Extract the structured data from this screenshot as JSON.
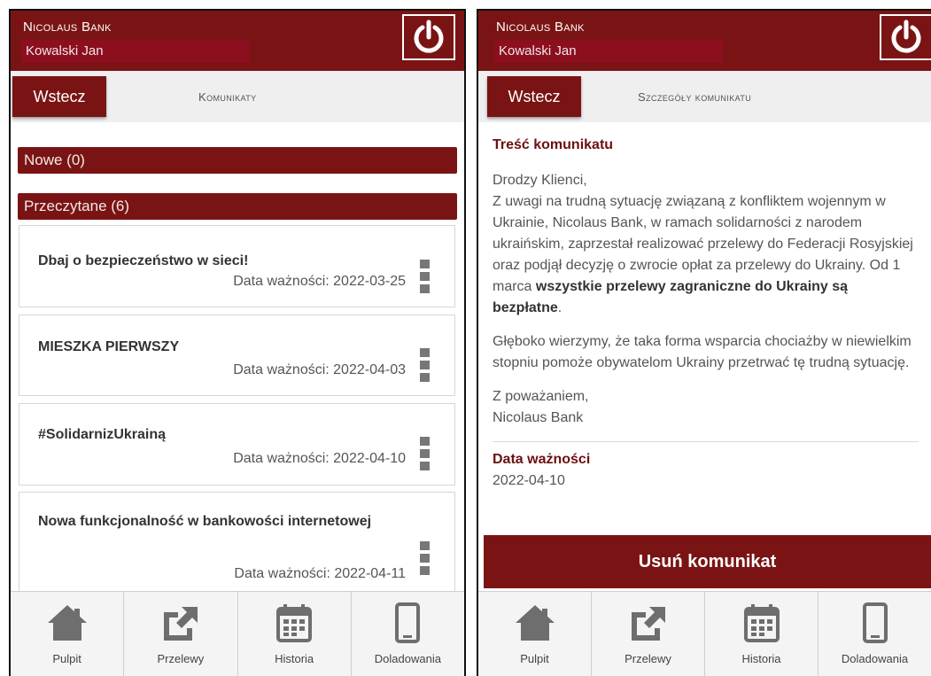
{
  "bank_name": "Nicolaus Bank",
  "user_name": "Kowalski Jan",
  "left": {
    "back_label": "Wstecz",
    "title": "Komunikaty",
    "new_section": "Nowe (0)",
    "read_section": "Przeczytane (6)",
    "messages": [
      {
        "title": "Dbaj o bezpieczeństwo w sieci!",
        "date": "Data ważności: 2022-03-25"
      },
      {
        "title": "MIESZKA PIERWSZY",
        "date": "Data ważności: 2022-04-03"
      },
      {
        "title": "#SolidarnizUkrainą",
        "date": "Data ważności: 2022-04-10"
      },
      {
        "title": "Nowa funkcjonalność w bankowości internetowej",
        "date": "Data ważności: 2022-04-11"
      }
    ]
  },
  "right": {
    "back_label": "Wstecz",
    "title": "Szczegóły komunikatu",
    "content_heading": "Treść komunikatu",
    "greeting": "Drodzy Klienci,",
    "para1_start": "Z uwagi na trudną sytuację związaną z konfliktem wojennym w Ukrainie, Nicolaus Bank, w ramach solidarności z narodem ukraińskim, zaprzestał realizować przelewy do Federacji Rosyjskiej oraz podjął decyzję o zwrocie opłat za przelewy do Ukrainy. Od 1 marca ",
    "para1_bold": "wszystkie przelewy zagraniczne do Ukrainy są bezpłatne",
    "para1_end": ".",
    "para2": "Głęboko wierzymy, że taka forma wsparcia chociażby w niewielkim stopniu pomoże obywatelom Ukrainy przetrwać tę trudną sytuację.",
    "closing": "Z poważaniem,",
    "signature": "Nicolaus Bank",
    "validity_heading": "Data ważności",
    "validity_date": "2022-04-10",
    "delete_label": "Usuń komunikat"
  },
  "nav": {
    "pulpit": "Pulpit",
    "przelewy": "Przelewy",
    "historia": "Historia",
    "doladowania": "Doladowania"
  },
  "colors": {
    "brand": "#7a1414",
    "nav_icon": "#6e6e6e"
  },
  "icons": {
    "power": "power-icon",
    "home": "home-icon",
    "transfer": "transfer-icon",
    "calendar": "calendar-icon",
    "phone": "phone-icon",
    "menu": "kebab-menu-icon"
  }
}
